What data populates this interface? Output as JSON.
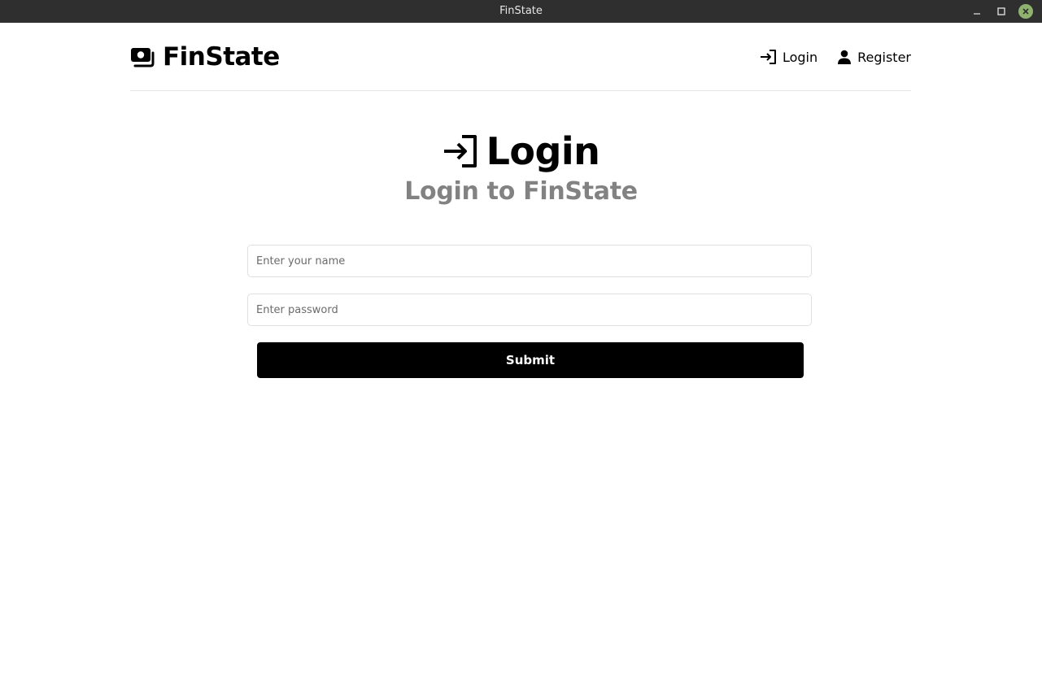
{
  "window": {
    "title": "FinState"
  },
  "navbar": {
    "brand": "FinState",
    "links": [
      {
        "label": "Login",
        "icon": "sign-in-icon"
      },
      {
        "label": "Register",
        "icon": "user-icon"
      }
    ]
  },
  "page": {
    "heading": "Login",
    "subheading": "Login to FinState"
  },
  "form": {
    "name_placeholder": "Enter your name",
    "password_placeholder": "Enter password",
    "submit_label": "Submit"
  },
  "colors": {
    "titlebar": "#2f2f2f",
    "primary": "#000000",
    "subheading": "#828282",
    "close_button": "#8fb36e"
  }
}
